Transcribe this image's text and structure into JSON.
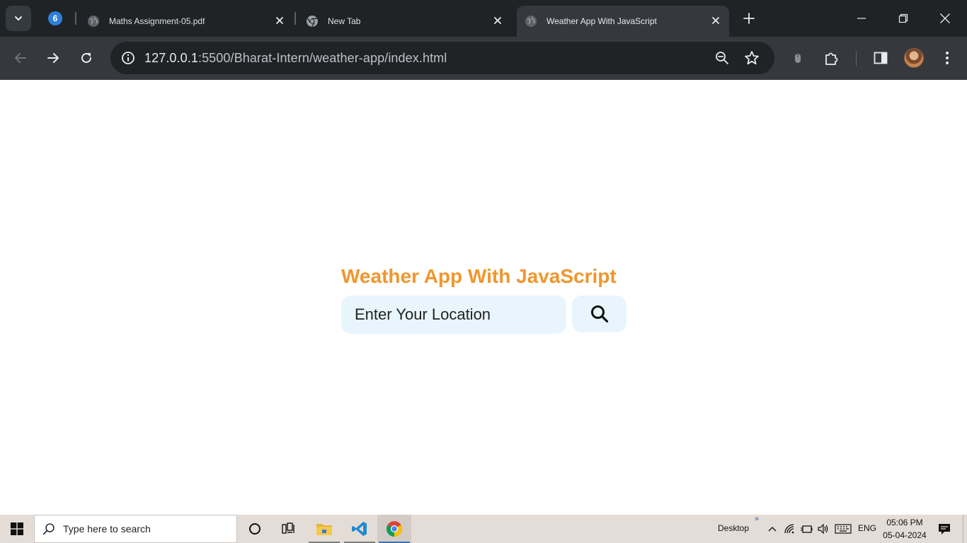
{
  "browser": {
    "tab_group_count": "6",
    "tabs": [
      {
        "title": "Maths Assignment-05.pdf",
        "favicon": "globe-icon",
        "active": false
      },
      {
        "title": "New Tab",
        "favicon": "chrome-icon",
        "active": false
      },
      {
        "title": "Weather App With JavaScript",
        "favicon": "globe-icon",
        "active": true
      }
    ],
    "address": {
      "host": "127.0.0.1",
      "path": ":5500/Bharat-Intern/weather-app/index.html"
    }
  },
  "page": {
    "title": "Weather App With JavaScript",
    "search_placeholder": "Enter Your Location",
    "accent_color": "#f0962e",
    "input_bg": "#e8f5fc"
  },
  "taskbar": {
    "search_placeholder": "Type here to search",
    "desktop_label": "Desktop",
    "chevron_text": "»",
    "language": "ENG",
    "time": "05:06 PM",
    "date": "05-04-2024"
  }
}
